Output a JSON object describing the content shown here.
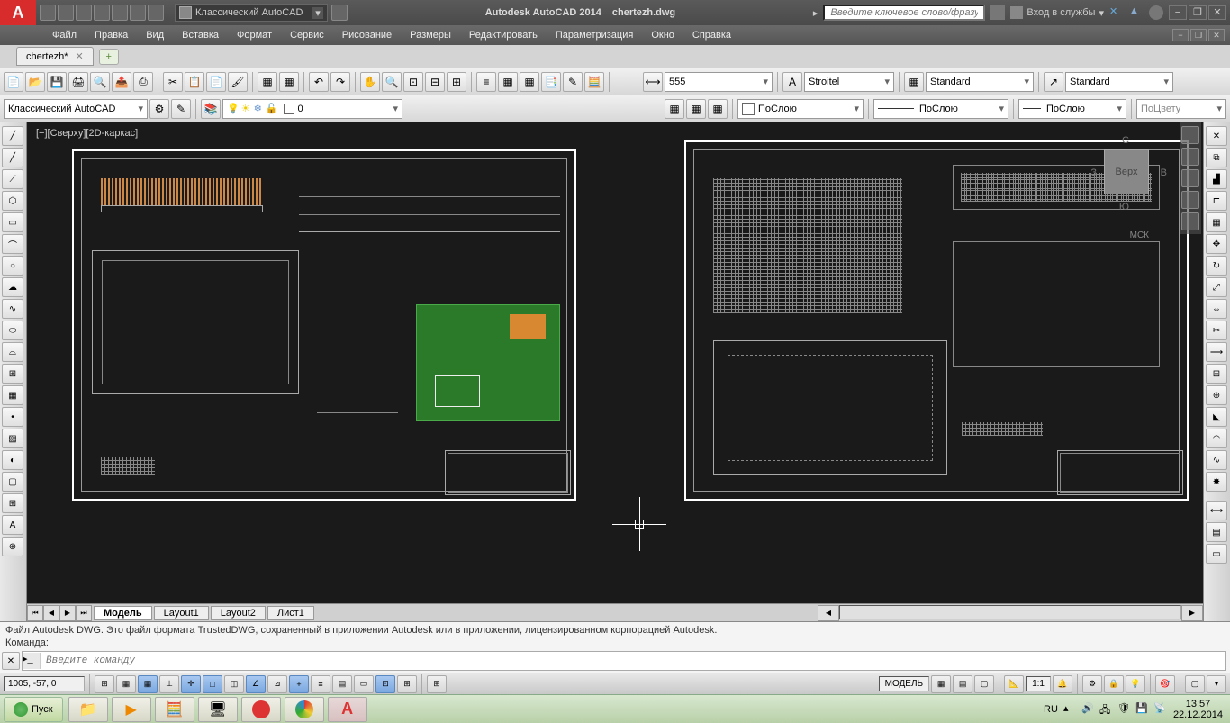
{
  "app": {
    "title": "Autodesk AutoCAD 2014",
    "filename": "chertezh.dwg",
    "workspace": "Классический AutoCAD",
    "search_placeholder": "Введите ключевое слово/фразу",
    "login": "Вход в службы"
  },
  "menu": [
    "Файл",
    "Правка",
    "Вид",
    "Вставка",
    "Формат",
    "Сервис",
    "Рисование",
    "Размеры",
    "Редактировать",
    "Параметризация",
    "Окно",
    "Справка"
  ],
  "filetab": {
    "name": "chertezh*"
  },
  "properties": {
    "dim_style": "555",
    "text_style": "Stroitel",
    "table_style": "Standard",
    "mleader_style": "Standard",
    "workspace2": "Классический AutoCAD",
    "layer": "0",
    "color": "ПоСлою",
    "linetype": "ПоСлою",
    "lineweight": "ПоСлою",
    "plot_style": "ПоЦвету"
  },
  "viewport": {
    "label": "[−][Сверху][2D-каркас]",
    "viewcube": "Верх",
    "compass": {
      "n": "С",
      "s": "Ю",
      "e": "В",
      "w": "З"
    },
    "wcs": "МСК"
  },
  "layout_tabs": [
    "Модель",
    "Layout1",
    "Layout2",
    "Лист1"
  ],
  "command": {
    "history1": "Файл Autodesk DWG. Это файл формата TrustedDWG, сохраненный в приложении Autodesk или в приложении, лицензированном корпорацией Autodesk.",
    "history2": "Команда:",
    "placeholder": "Введите команду"
  },
  "status": {
    "coords": "1005, -57, 0",
    "model": "МОДЕЛЬ",
    "scale": "1:1",
    "lang": "RU"
  },
  "taskbar": {
    "start": "Пуск",
    "time": "13:57",
    "date": "22.12.2014"
  }
}
